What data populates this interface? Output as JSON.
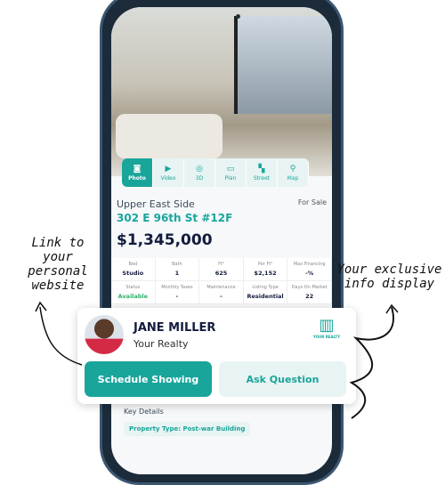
{
  "annotations": {
    "left": "Link to your personal website",
    "right": "Your exclusive info display"
  },
  "tabs": [
    {
      "label": "Photo",
      "icon": "camera-icon",
      "glyph": "◙"
    },
    {
      "label": "Video",
      "icon": "video-icon",
      "glyph": "▶"
    },
    {
      "label": "3D",
      "icon": "3d-icon",
      "glyph": "◎"
    },
    {
      "label": "Plan",
      "icon": "plan-icon",
      "glyph": "▭"
    },
    {
      "label": "Street",
      "icon": "street-icon",
      "glyph": "▚"
    },
    {
      "label": "Map",
      "icon": "map-pin-icon",
      "glyph": "⚲"
    }
  ],
  "listing": {
    "neighborhood": "Upper East Side",
    "status_label": "For Sale",
    "address": "302 E 96th St #12F",
    "price": "$1,345,000"
  },
  "facts": [
    {
      "label": "Bed",
      "value": "Studio"
    },
    {
      "label": "Bath",
      "value": "1"
    },
    {
      "label": "Ft²",
      "value": "625"
    },
    {
      "label": "Per Ft²",
      "value": "$2,152"
    },
    {
      "label": "Max Financing",
      "value": "-%"
    },
    {
      "label": "Status",
      "value": "Available"
    },
    {
      "label": "Monthly Taxes",
      "value": "-"
    },
    {
      "label": "Maintenance",
      "value": "-"
    },
    {
      "label": "Listing Type",
      "value": "Residential"
    },
    {
      "label": "Days On Market",
      "value": "22"
    }
  ],
  "agent": {
    "name": "JANE MILLER",
    "company": "Your Realty",
    "logo_text": "YOUR REALTY"
  },
  "actions": {
    "schedule": "Schedule Showing",
    "ask": "Ask Question"
  },
  "key_details": {
    "title": "Key Details",
    "chip": "Property Type: Post-war Building"
  },
  "colors": {
    "accent": "#1aa59b",
    "navy": "#131c3d",
    "available": "#2db06b"
  }
}
